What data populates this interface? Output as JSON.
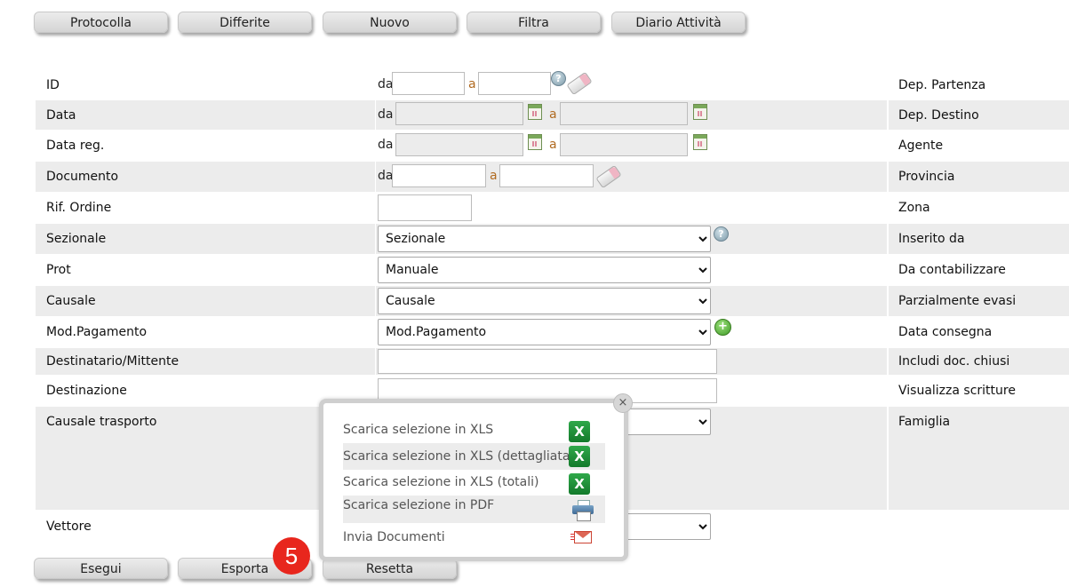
{
  "top_buttons": [
    "Protocolla",
    "Differite",
    "Nuovo",
    "Filtra",
    "Diario Attività"
  ],
  "range": {
    "from": "da",
    "to": "a"
  },
  "fields": {
    "id": "ID",
    "data": "Data",
    "data_reg": "Data reg.",
    "documento": "Documento",
    "rif_ordine": "Rif. Ordine",
    "sezionale": "Sezionale",
    "prot": "Prot",
    "causale": "Causale",
    "mod_pagamento": "Mod.Pagamento",
    "destinatario": "Destinatario/Mittente",
    "destinazione": "Destinazione",
    "causale_trasporto": "Causale trasporto",
    "vettore": "Vettore"
  },
  "selects": {
    "sezionale": "Sezionale",
    "prot": "Manuale",
    "causale": "Causale",
    "mod_pagamento": "Mod.Pagamento"
  },
  "right_labels": {
    "r1": "Dep. Partenza",
    "r2": "Dep. Destino",
    "r3": "Agente",
    "r4": "Provincia",
    "r5": "Zona",
    "r6": "Inserito da",
    "r7": "Da contabilizzare",
    "r8": "Parzialmente evasi",
    "r9": "Data consegna",
    "r10": "Includi doc. chiusi",
    "r11": "Visualizza scritture",
    "r12": "Famiglia"
  },
  "export_menu": {
    "items": [
      "Scarica selezione in XLS",
      "Scarica selezione in XLS (dettagliata)",
      "Scarica selezione in XLS (totali)",
      "Scarica selezione in PDF",
      "Invia Documenti"
    ],
    "close_glyph": "×"
  },
  "bottom_buttons": [
    "Esegui",
    "Esporta",
    "Resetta"
  ],
  "step_badge": "5",
  "icons": {
    "help_glyph": "?",
    "plus_glyph": "+",
    "xls_glyph": "X"
  },
  "colors": {
    "badge": "#e8261d",
    "row_shade": "#ececec",
    "range_sep": "#b06a20"
  }
}
